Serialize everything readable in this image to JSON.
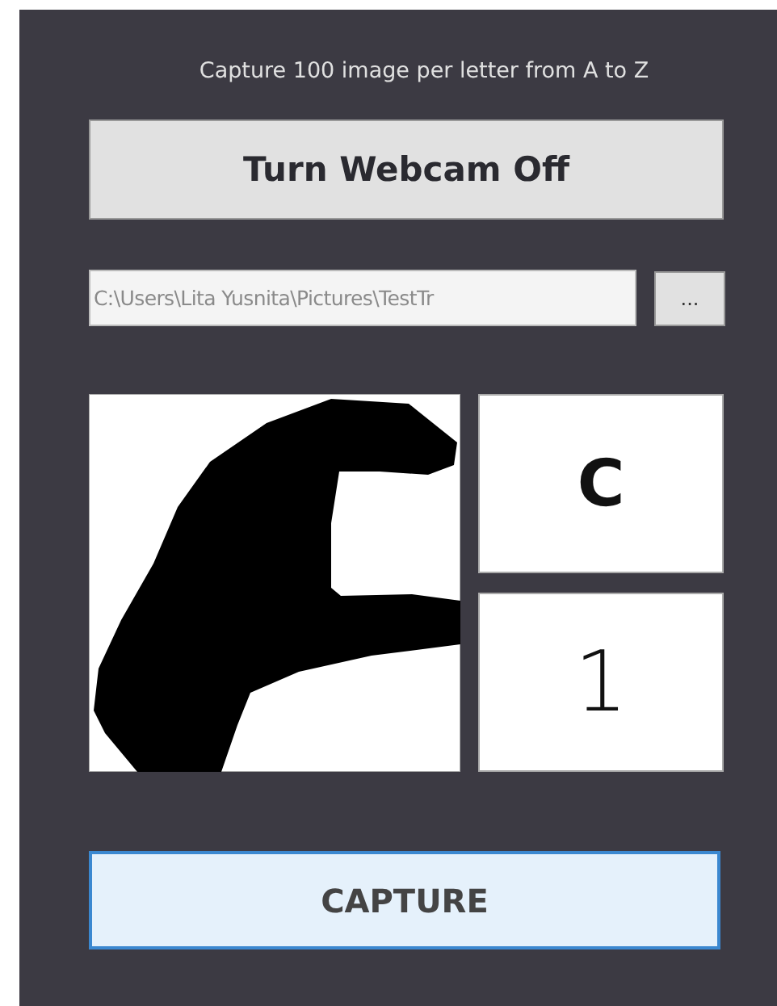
{
  "instruction": "Capture 100 image per letter from A to Z",
  "webcam_button": "Turn Webcam Off",
  "folder_path": {
    "value": "C:\\Users\\Lita Yusnita\\Pictures\\TestTr"
  },
  "browse_button": "...",
  "letter": "C",
  "count": "1",
  "capture_button": "CAPTURE"
}
